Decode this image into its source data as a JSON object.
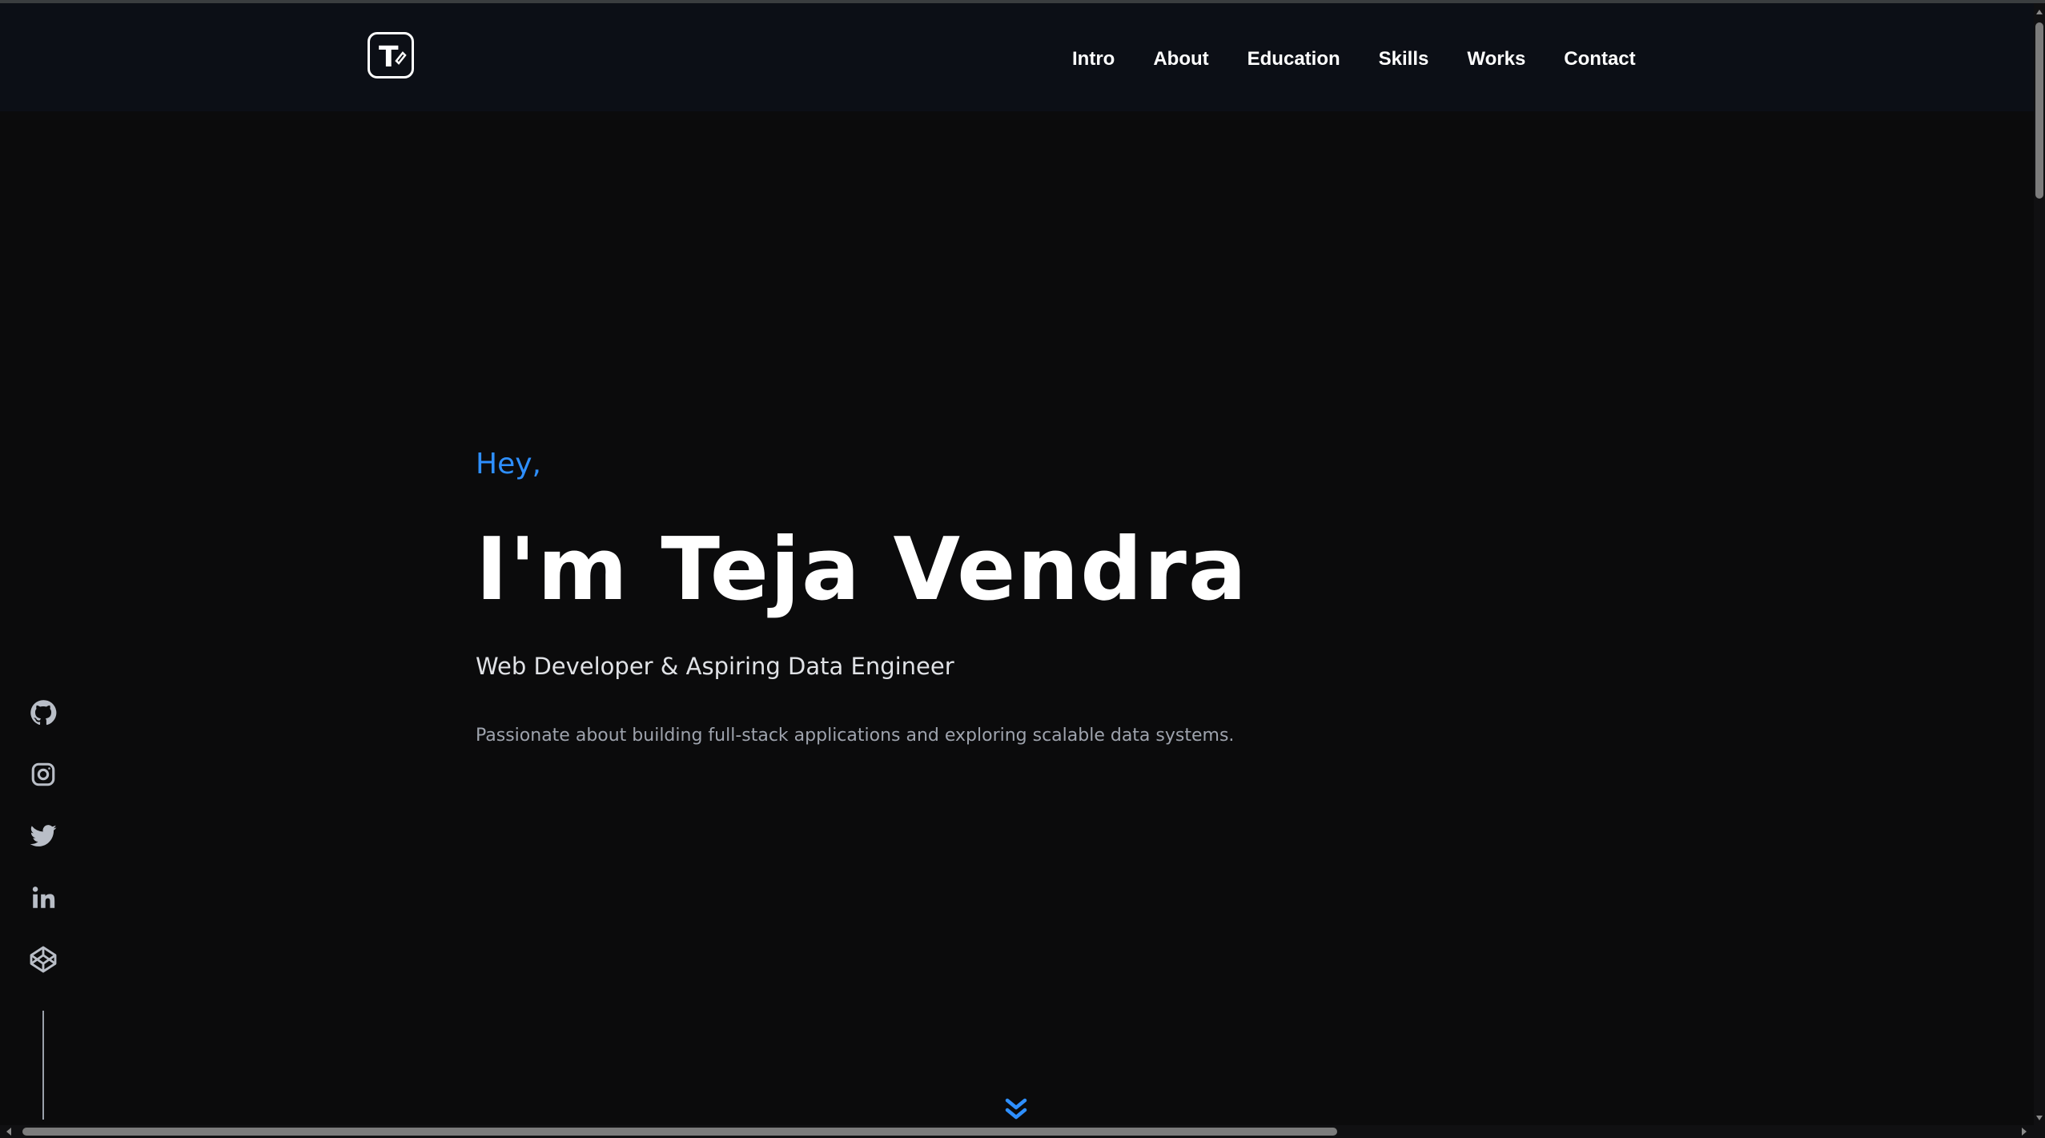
{
  "nav": {
    "logo_letter": "T",
    "links": [
      "Intro",
      "About",
      "Education",
      "Skills",
      "Works",
      "Contact"
    ]
  },
  "hero": {
    "greeting": "Hey,",
    "name": "I'm Teja Vendra",
    "role": "Web Developer & Aspiring Data Engineer",
    "description": "Passionate about building full-stack applications and exploring scalable data systems."
  },
  "social": {
    "icons": [
      "github-icon",
      "instagram-icon",
      "twitter-icon",
      "linkedin-icon",
      "codepen-icon"
    ]
  },
  "colors": {
    "background": "#0b0b0c",
    "navbar": "#0c0f16",
    "accent": "#2e8fff",
    "text": "#ffffff",
    "muted": "#9ea3ad"
  }
}
